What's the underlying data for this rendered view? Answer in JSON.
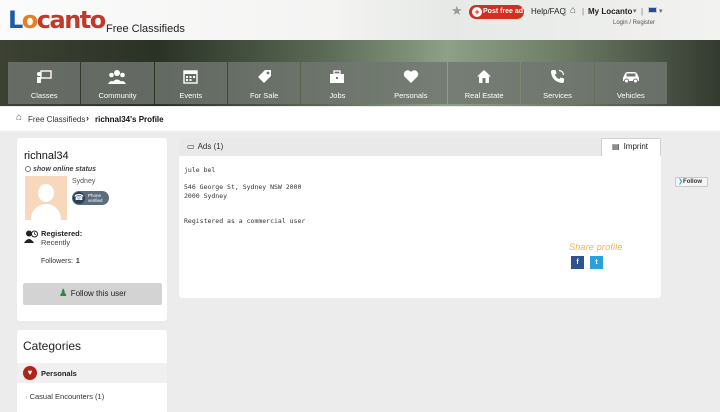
{
  "header": {
    "logo_parts": [
      "L",
      "o",
      "canto"
    ],
    "tagline": "Free Classifieds",
    "post_ad_label": "Post free ad",
    "help_label": "Help/FAQ",
    "my_locanto_label": "My Locanto",
    "login_label": "Login / Register"
  },
  "nav": {
    "items": [
      {
        "label": "Classes",
        "icon": "classes-icon"
      },
      {
        "label": "Community",
        "icon": "community-icon"
      },
      {
        "label": "Events",
        "icon": "calendar-icon"
      },
      {
        "label": "For Sale",
        "icon": "price-tag-icon"
      },
      {
        "label": "Jobs",
        "icon": "briefcase-icon"
      },
      {
        "label": "Personals",
        "icon": "heart-icon"
      },
      {
        "label": "Real Estate",
        "icon": "house-icon"
      },
      {
        "label": "Services",
        "icon": "phone-icon"
      },
      {
        "label": "Vehicles",
        "icon": "car-icon"
      }
    ]
  },
  "breadcrumb": {
    "root": "Free Classifieds",
    "current": "richnal34's Profile"
  },
  "profile": {
    "username": "richnal34",
    "online_status": "show online status",
    "city": "Sydney",
    "phone_badge_line1": "Phone",
    "phone_badge_line2": "verified",
    "registered_label": "Registered:",
    "registered_value": "Recently",
    "followers_label": "Followers:",
    "followers_count": "1",
    "follow_button": "Follow this user"
  },
  "categories": {
    "title": "Categories",
    "group": "Personals",
    "items": [
      {
        "label": "Casual Encounters (1)"
      }
    ]
  },
  "content": {
    "tab_ads": "Ads (1)",
    "tab_imprint": "Imprint",
    "name": "jule bel",
    "address_line1": "546 George St, Sydney NSW 2000",
    "address_line2": "2000 Sydney",
    "commercial_note": "Registered as a commercial user",
    "share_label": "Share profile",
    "share_fb": "f",
    "share_tw": "t"
  },
  "twitter_follow": "Follow",
  "colors": {
    "logo_blue": "#1b5bab",
    "logo_orange": "#e67e22",
    "post_ad_red": "#d42e1f",
    "follow_green": "#2e8b3a",
    "share_orange": "#f0b24a",
    "facebook_blue": "#2f5290",
    "twitter_blue": "#2ba1db"
  }
}
